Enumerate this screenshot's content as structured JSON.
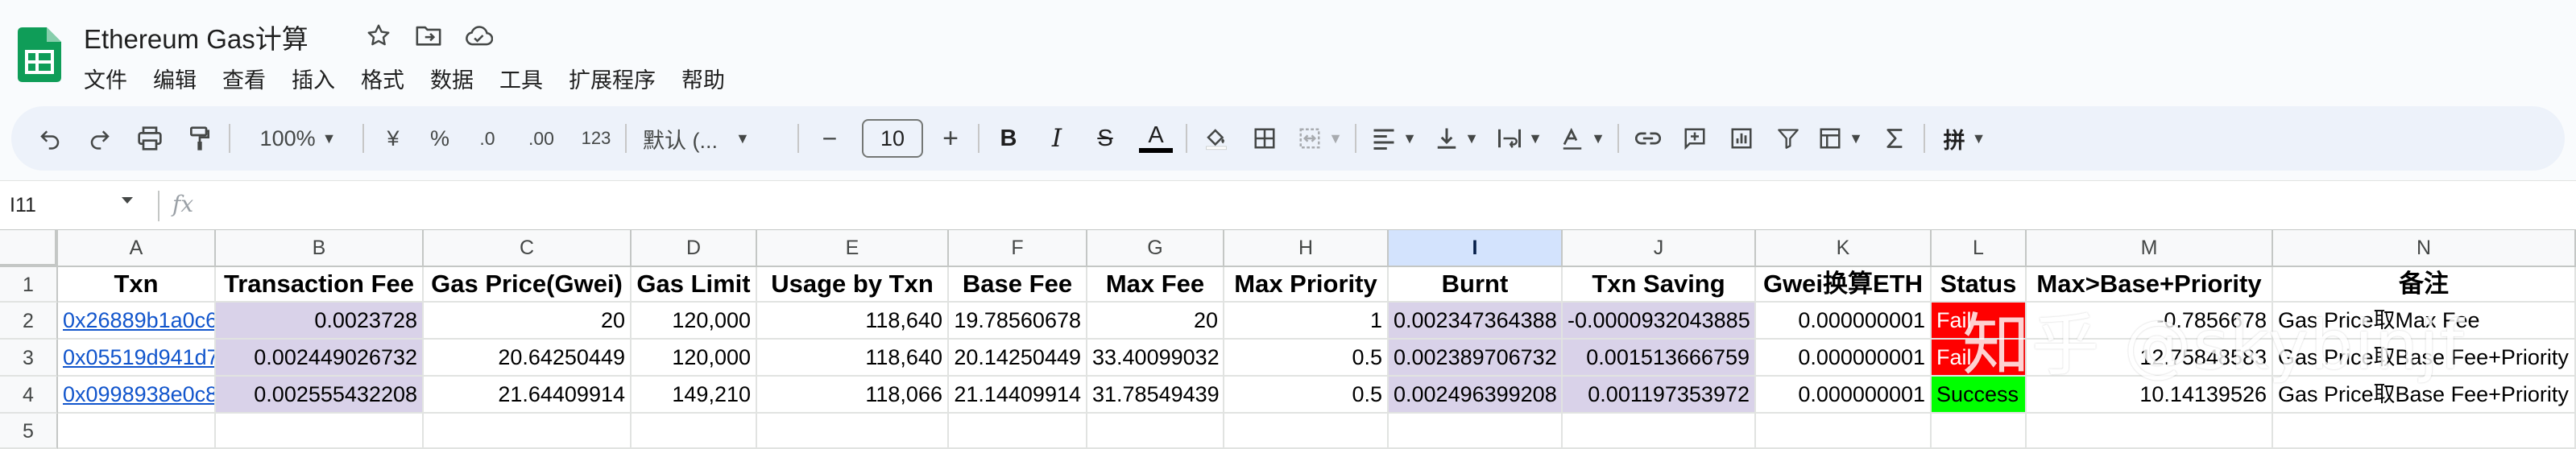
{
  "title_bar": {
    "doc_title": "Ethereum Gas计算"
  },
  "menu": [
    "文件",
    "编辑",
    "查看",
    "插入",
    "格式",
    "数据",
    "工具",
    "扩展程序",
    "帮助"
  ],
  "toolbar": {
    "zoom": "100%",
    "currency": "¥",
    "percent": "%",
    "dec_decrease": ".0",
    "dec_increase": ".00",
    "number_format": "123",
    "font": "默认 (...",
    "font_size": "10",
    "minus": "−",
    "plus": "+",
    "bold": "B",
    "italic": "I",
    "strike": "S",
    "text_color": "A",
    "input_tools": "拼"
  },
  "formula_bar": {
    "name_box": "I11",
    "fx": "fx",
    "value": ""
  },
  "columns": [
    "A",
    "B",
    "C",
    "D",
    "E",
    "F",
    "G",
    "H",
    "I",
    "J",
    "K",
    "L",
    "M",
    "N"
  ],
  "selected_column": "I",
  "rows": [
    "1",
    "2",
    "3",
    "4",
    "5"
  ],
  "header_row": [
    "Txn",
    "Transaction Fee",
    "Gas Price(Gwei)",
    "Gas Limit",
    "Usage by Txn",
    "Base Fee",
    "Max Fee",
    "Max Priority",
    "Burnt",
    "Txn Saving",
    "Gwei换算ETH",
    "Status",
    "Max>Base+Priority",
    "备注"
  ],
  "data_rows": [
    [
      "0x26889b1a0c6",
      "0.0023728",
      "20",
      "120,000",
      "118,640",
      "19.78560678",
      "20",
      "1",
      "0.002347364388",
      "-0.0000932043885",
      "0.000000001",
      "Fail",
      "-0.7856678",
      "Gas Price取Max Fee"
    ],
    [
      "0x05519d941d7",
      "0.002449026732",
      "20.64250449",
      "120,000",
      "118,640",
      "20.14250449",
      "33.40099032",
      "0.5",
      "0.002389706732",
      "0.001513666759",
      "0.000000001",
      "Fail",
      "12.75848583",
      "Gas Price取Base Fee+Priority"
    ],
    [
      "0x0998938e0c8",
      "0.002555432208",
      "21.64409914",
      "149,210",
      "118,066",
      "21.14409914",
      "31.78549439",
      "0.5",
      "0.002496399208",
      "0.001197353972",
      "0.000000001",
      "Success",
      "10.14139526",
      "Gas Price取Base Fee+Priority"
    ],
    [
      "",
      "",
      "",
      "",
      "",
      "",
      "",
      "",
      "",
      "",
      "",
      "",
      "",
      ""
    ]
  ],
  "status_colors": {
    "fail": "#ff0000",
    "success": "#00ff00",
    "highlight": "#d9d2e9",
    "selected_header": "#d3e3fd",
    "brand_green": "#0f9d58"
  },
  "watermark": "知乎 @skybinjf",
  "icons": [
    "sheets-logo-icon",
    "star-icon",
    "move-to-folder-icon",
    "cloud-status-icon",
    "undo-icon",
    "redo-icon",
    "print-icon",
    "paint-format-icon"
  ]
}
